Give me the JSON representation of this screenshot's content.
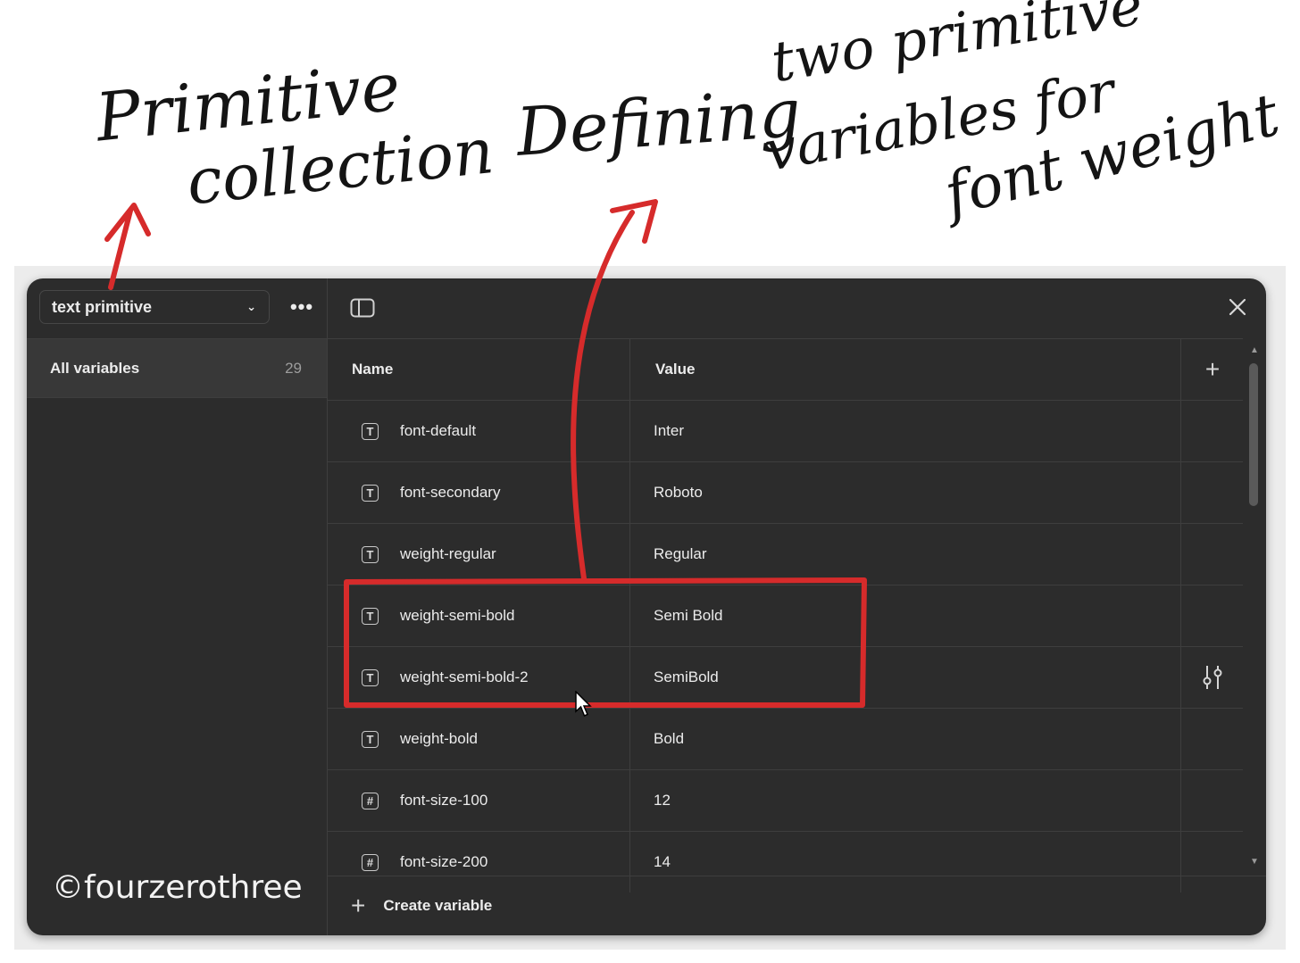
{
  "annotations": {
    "primitive": "Primitive",
    "collection": "collection",
    "defining": "Defining",
    "two_primitive": "two primitive",
    "variables_for": "variables for",
    "font_weight": "font weight",
    "arrow_color": "#d62b2b"
  },
  "watermark": "©fourzerothree",
  "sidebar": {
    "collection_select": "text primitive",
    "more_icon": "ellipsis-icon",
    "items": [
      {
        "label": "All variables",
        "count": "29"
      }
    ]
  },
  "table": {
    "headers": {
      "name": "Name",
      "value": "Value"
    },
    "rows": [
      {
        "icon": "text-type-icon",
        "glyph": "T",
        "name": "font-default",
        "value": "Inter"
      },
      {
        "icon": "text-type-icon",
        "glyph": "T",
        "name": "font-secondary",
        "value": "Roboto"
      },
      {
        "icon": "text-type-icon",
        "glyph": "T",
        "name": "weight-regular",
        "value": "Regular"
      },
      {
        "icon": "text-type-icon",
        "glyph": "T",
        "name": "weight-semi-bold",
        "value": "Semi Bold"
      },
      {
        "icon": "text-type-icon",
        "glyph": "T",
        "name": "weight-semi-bold-2",
        "value": "SemiBold"
      },
      {
        "icon": "text-type-icon",
        "glyph": "T",
        "name": "weight-bold",
        "value": "Bold"
      },
      {
        "icon": "number-type-icon",
        "glyph": "#",
        "name": "font-size-100",
        "value": "12"
      },
      {
        "icon": "number-type-icon",
        "glyph": "#",
        "name": "font-size-200",
        "value": "14"
      }
    ]
  },
  "footer": {
    "create_label": "Create variable"
  },
  "colors": {
    "panel_bg": "#2c2c2c",
    "selected_item_bg": "#383838",
    "border": "#3e3e3e",
    "text": "#ececec",
    "highlight_box": "#d62b2b"
  }
}
